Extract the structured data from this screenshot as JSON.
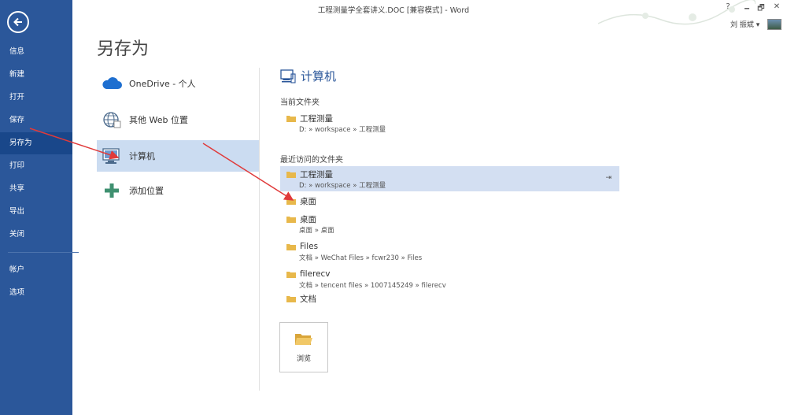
{
  "window": {
    "title": "工程测量学全套讲义.DOC [兼容模式] - Word",
    "controls": [
      "?",
      "🗕",
      "🗗",
      "✕"
    ],
    "user": "刘 振斌 ▾"
  },
  "nav": {
    "items": [
      {
        "label": "信息"
      },
      {
        "label": "新建"
      },
      {
        "label": "打开"
      },
      {
        "label": "保存"
      },
      {
        "label": "另存为"
      },
      {
        "label": "打印"
      },
      {
        "label": "共享"
      },
      {
        "label": "导出"
      },
      {
        "label": "关闭"
      },
      {
        "label": "帐户"
      },
      {
        "label": "选项"
      }
    ],
    "active": "另存为"
  },
  "page_title": "另存为",
  "places": [
    {
      "label": "OneDrive - 个人",
      "icon": "cloud-icon"
    },
    {
      "label": "其他 Web 位置",
      "icon": "globe-icon"
    },
    {
      "label": "计算机",
      "icon": "computer-icon"
    },
    {
      "label": "添加位置",
      "icon": "plus-icon"
    }
  ],
  "right": {
    "title": "计算机",
    "current_header": "当前文件夹",
    "recent_header": "最近访问的文件夹",
    "current_folder": {
      "name": "工程测量",
      "path": "D: » workspace » 工程测量"
    },
    "recent_folders": [
      {
        "name": "工程测量",
        "path": "D: » workspace » 工程测量"
      },
      {
        "name": "桌面",
        "path": ""
      },
      {
        "name": "桌面",
        "path": "桌面 » 桌面"
      },
      {
        "name": "Files",
        "path": "文档 » WeChat Files » fcwr230 » Files"
      },
      {
        "name": "filerecv",
        "path": "文档 » tencent files » 1007145249 » filerecv"
      },
      {
        "name": "文档",
        "path": ""
      }
    ],
    "browse_label": "浏览"
  },
  "colors": {
    "accent": "#2b579a",
    "nav_active": "#19478a",
    "selection": "#cbdcf1",
    "folder": "#e8b84b"
  }
}
